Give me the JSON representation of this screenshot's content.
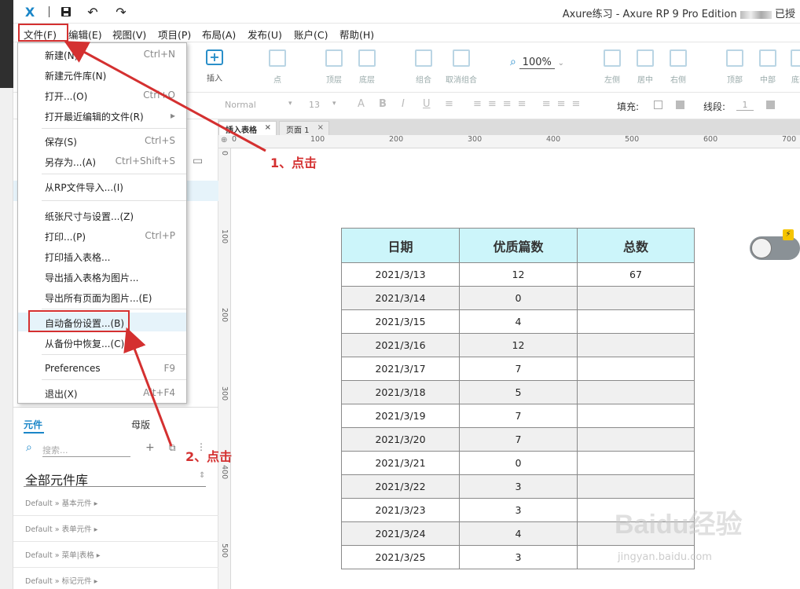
{
  "window": {
    "title": "Axure练习 - Axure RP 9 Pro Edition",
    "title_suffix": "已授"
  },
  "menubar": [
    "文件(F)",
    "编辑(E)",
    "视图(V)",
    "项目(P)",
    "布局(A)",
    "发布(U)",
    "账户(C)",
    "帮助(H)"
  ],
  "toolbar": {
    "insert_label": "插入",
    "point_label": "点",
    "top_label": "顶层",
    "bottom_label": "底层",
    "group_label": "组合",
    "ungroup_label": "取消组合",
    "zoom_value": "100%",
    "align_labels": [
      "左侧",
      "居中",
      "右侧",
      "顶部",
      "中部",
      "底部"
    ]
  },
  "formatbar": {
    "style_value": "Normal",
    "font_size": "13",
    "fill_label": "填充:",
    "line_label": "线段:",
    "line_value": "1"
  },
  "tabs": [
    {
      "label": "插入表格",
      "active": true
    },
    {
      "label": "页面 1",
      "active": false
    }
  ],
  "ruler": {
    "h_ticks": [
      "0",
      "100",
      "200",
      "300",
      "400",
      "500",
      "600",
      "700"
    ],
    "v_ticks": [
      "0",
      "100",
      "200",
      "300",
      "400",
      "500"
    ]
  },
  "file_menu": [
    {
      "label": "新建(N)",
      "shortcut": "Ctrl+N"
    },
    {
      "label": "新建元件库(N)",
      "shortcut": ""
    },
    {
      "label": "打开...(O)",
      "shortcut": "Ctrl+O"
    },
    {
      "label": "打开最近编辑的文件(R)",
      "shortcut": "▸"
    },
    {
      "label": "保存(S)",
      "shortcut": "Ctrl+S"
    },
    {
      "label": "另存为...(A)",
      "shortcut": "Ctrl+Shift+S"
    },
    {
      "label": "从RP文件导入...(I)",
      "shortcut": ""
    },
    {
      "label": "纸张尺寸与设置...(Z)",
      "shortcut": ""
    },
    {
      "label": "打印...(P)",
      "shortcut": "Ctrl+P"
    },
    {
      "label": "打印插入表格...",
      "shortcut": ""
    },
    {
      "label": "导出插入表格为图片...",
      "shortcut": ""
    },
    {
      "label": "导出所有页面为图片...(E)",
      "shortcut": ""
    },
    {
      "label": "自动备份设置...(B)",
      "shortcut": ""
    },
    {
      "label": "从备份中恢复...(C)",
      "shortcut": ""
    },
    {
      "label": "Preferences",
      "shortcut": "F9"
    },
    {
      "label": "退出(X)",
      "shortcut": "Alt+F4"
    }
  ],
  "libraries": {
    "tab_widgets": "元件",
    "tab_masters": "母版",
    "search_placeholder": "搜索...",
    "library_select": "全部元件库",
    "groups": [
      "Default » 基本元件 ▸",
      "Default » 表单元件 ▸",
      "Default » 菜单|表格 ▸",
      "Default » 标记元件 ▸"
    ]
  },
  "table": {
    "headers": [
      "日期",
      "优质篇数",
      "总数"
    ],
    "rows": [
      [
        "2021/3/13",
        "12",
        "67"
      ],
      [
        "2021/3/14",
        "0",
        ""
      ],
      [
        "2021/3/15",
        "4",
        ""
      ],
      [
        "2021/3/16",
        "12",
        ""
      ],
      [
        "2021/3/17",
        "7",
        ""
      ],
      [
        "2021/3/18",
        "5",
        ""
      ],
      [
        "2021/3/19",
        "7",
        ""
      ],
      [
        "2021/3/20",
        "7",
        ""
      ],
      [
        "2021/3/21",
        "0",
        ""
      ],
      [
        "2021/3/22",
        "3",
        ""
      ],
      [
        "2021/3/23",
        "3",
        ""
      ],
      [
        "2021/3/24",
        "4",
        ""
      ],
      [
        "2021/3/25",
        "3",
        ""
      ]
    ]
  },
  "annotations": {
    "step1": "1、点击",
    "step2": "2、点击"
  },
  "watermark": {
    "brand": "Baidu经验",
    "url": "jingyan.baidu.com"
  },
  "colors": {
    "annotation_red": "#d43030",
    "table_header": "#ccf5fa",
    "accent": "#1a86c8"
  }
}
